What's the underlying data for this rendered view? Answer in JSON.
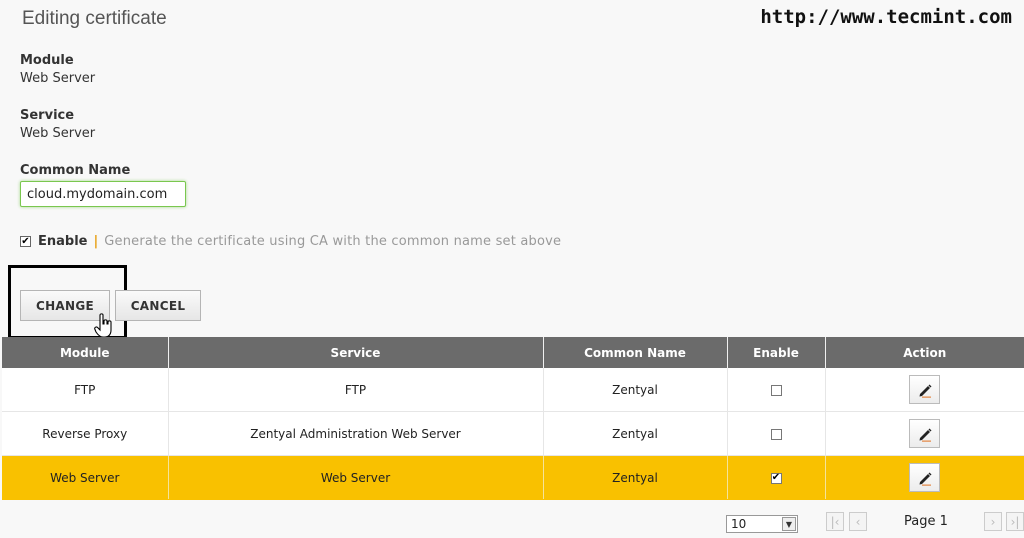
{
  "header": {
    "title": "Editing certificate",
    "watermark": "http://www.tecmint.com"
  },
  "form": {
    "module": {
      "label": "Module",
      "value": "Web Server"
    },
    "service": {
      "label": "Service",
      "value": "Web Server"
    },
    "common_name": {
      "label": "Common Name",
      "value": "cloud.mydomain.com"
    },
    "enable": {
      "label": "Enable",
      "separator": "|",
      "help": "Generate the certificate using CA with the common name set above",
      "checked": true
    },
    "change_label": "CHANGE",
    "cancel_label": "CANCEL"
  },
  "table": {
    "columns": [
      "Module",
      "Service",
      "Common Name",
      "Enable",
      "Action"
    ],
    "rows": [
      {
        "module": "FTP",
        "service": "FTP",
        "common_name": "Zentyal",
        "enabled": false
      },
      {
        "module": "Reverse Proxy",
        "service": "Zentyal Administration Web Server",
        "common_name": "Zentyal",
        "enabled": false
      },
      {
        "module": "Web Server",
        "service": "Web Server",
        "common_name": "Zentyal",
        "enabled": true
      }
    ],
    "selected_row_color": "#f9c100",
    "header_color": "#6b6b6b"
  },
  "pagination": {
    "page_size": "10",
    "page_label": "Page 1"
  },
  "icons": {
    "edit": "pencil-icon",
    "cursor": "hand-pointer-icon",
    "first": "first-page-icon",
    "prev": "prev-page-icon",
    "next": "next-page-icon",
    "last": "last-page-icon"
  }
}
